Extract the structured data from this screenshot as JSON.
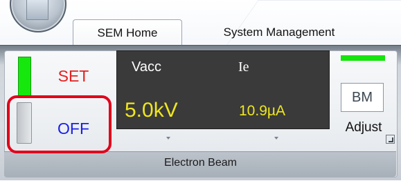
{
  "tabs": [
    {
      "label": "SEM Home",
      "active": true
    },
    {
      "label": "System Management",
      "active": false
    }
  ],
  "electron_beam": {
    "group_label": "Electron Beam",
    "set_label": "SET",
    "off_label": "OFF",
    "vacc": {
      "label": "Vacc",
      "value": "5.0kV"
    },
    "ie": {
      "label": "Ie",
      "value": "10.9µA"
    },
    "bm_label": "BM",
    "adjust_label": "Adjust"
  },
  "colors": {
    "set_text": "#e41f1f",
    "off_text": "#1a1ee6",
    "indicator_on": "#16e80e",
    "display_bg": "#3a3a3a",
    "display_value": "#f0e71d",
    "highlight": "#e1001b"
  },
  "icons": {
    "app_orb": "app-orb-icon",
    "dropdown": "chevron-down-icon",
    "group_launcher": "dialog-launcher-icon"
  }
}
